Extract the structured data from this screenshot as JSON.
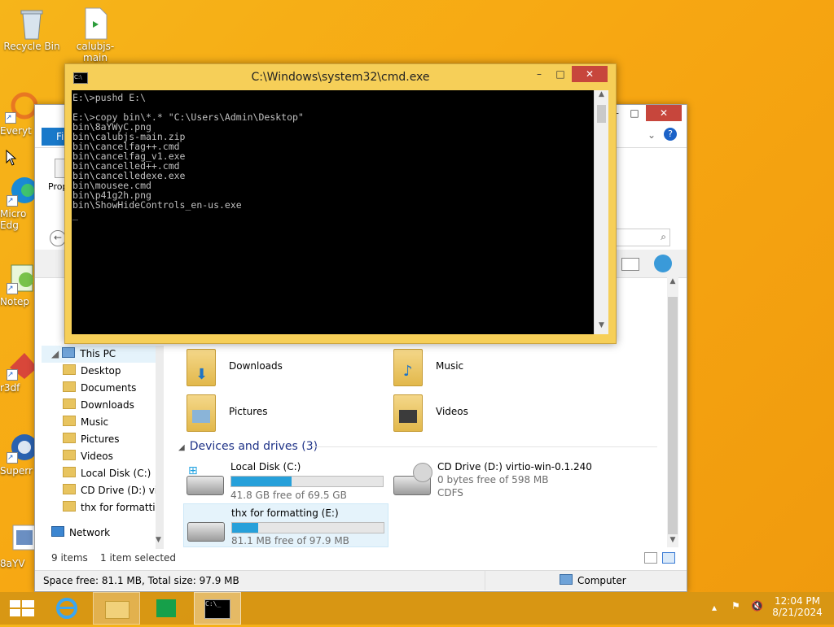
{
  "desktop": {
    "icons": [
      {
        "label": "Recycle Bin"
      },
      {
        "label": "calubjs-main"
      },
      {
        "label": "Everyt"
      },
      {
        "label": "Micro Edg"
      },
      {
        "label": "Notep"
      },
      {
        "label": "r3df"
      },
      {
        "label": "Superr"
      },
      {
        "label": "8aYV"
      }
    ]
  },
  "cmd": {
    "title": "C:\\Windows\\system32\\cmd.exe",
    "lines": [
      "E:\\>pushd E:\\",
      "",
      "E:\\>copy bin\\*.* \"C:\\Users\\Admin\\Desktop\"",
      "bin\\8aYWyC.png",
      "bin\\calubjs-main.zip",
      "bin\\cancelfag++.cmd",
      "bin\\cancelfag_v1.exe",
      "bin\\cancelled++.cmd",
      "bin\\cancelledexe.exe",
      "bin\\mousee.cmd",
      "bin\\p41g2h.png",
      "bin\\ShowHideControls_en-us.exe",
      "_"
    ]
  },
  "explorer": {
    "ribbon_partial": {
      "file_tab": "Fi",
      "props": "Prop"
    },
    "nav": {
      "this_pc": "This PC",
      "items": [
        "Desktop",
        "Documents",
        "Downloads",
        "Music",
        "Pictures",
        "Videos",
        "Local Disk (C:)",
        "CD Drive (D:) virt",
        "thx for formatting"
      ],
      "network": "Network"
    },
    "folders": [
      "Downloads",
      "Music",
      "Pictures",
      "Videos"
    ],
    "devices_header": "Devices and drives (3)",
    "drives": [
      {
        "name": "Local Disk (C:)",
        "free": "41.8 GB free of 69.5 GB",
        "used_fraction": 0.4
      },
      {
        "name": "CD Drive (D:) virtio-win-0.1.240",
        "free": "0 bytes free of 598 MB",
        "fs": "CDFS"
      },
      {
        "name": "thx for formatting (E:)",
        "free": "81.1 MB free of 97.9 MB",
        "used_fraction": 0.17
      }
    ],
    "status": {
      "items": "9 items",
      "selected": "1 item selected"
    },
    "details_bar": {
      "space": "Space free: 81.1 MB, Total size: 97.9 MB",
      "location": "Computer"
    }
  },
  "taskbar": {
    "time": "12:04 PM",
    "date": "8/21/2024"
  }
}
